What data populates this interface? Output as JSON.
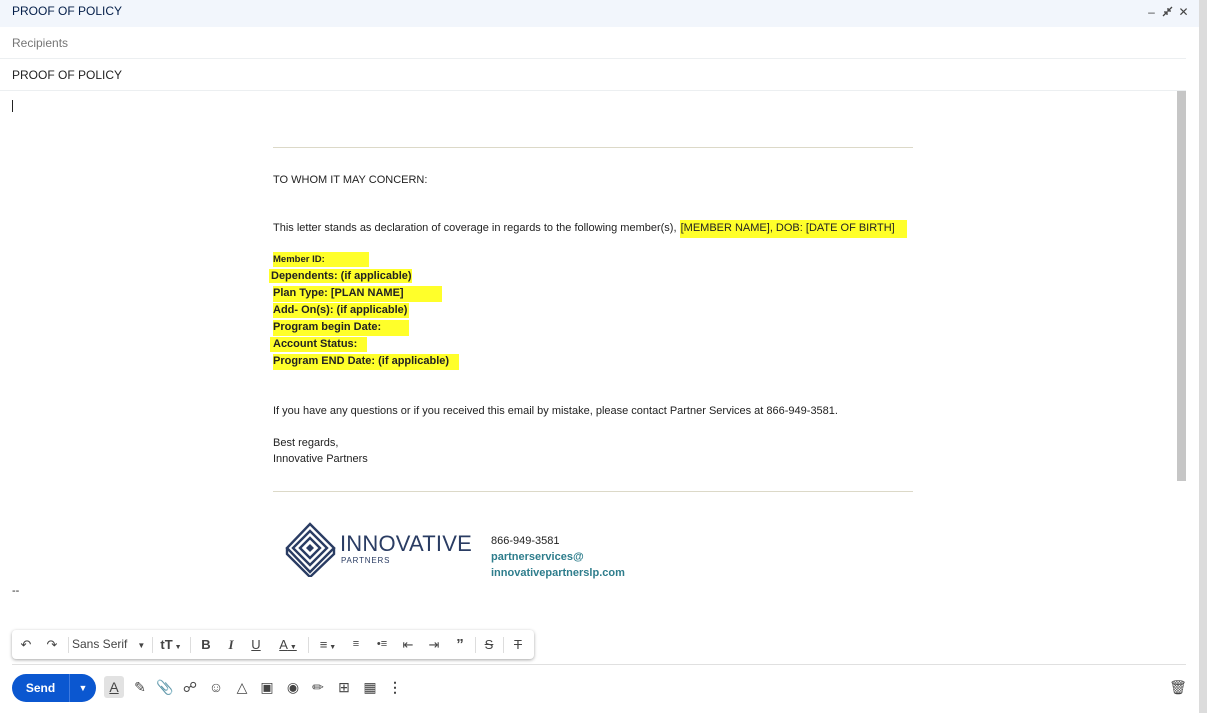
{
  "window": {
    "title": "PROOF OF POLICY",
    "minimize_icon": "minimize-icon",
    "popout_icon": "exit-fullscreen-icon",
    "close_icon": "close-icon"
  },
  "recipients": {
    "placeholder": "Recipients"
  },
  "subject": {
    "value": "PROOF OF POLICY"
  },
  "letter": {
    "salutation": "TO WHOM IT MAY CONCERN:",
    "intro": "This letter stands as declaration of coverage in regards to the following member(s),",
    "intro_highlight": "[MEMBER NAME], DOB:  [DATE OF BIRTH]",
    "fields": [
      "Member ID:",
      "Dependents: (if applicable)",
      "Plan Type:  [PLAN NAME]",
      "Add- On(s): (if applicable)",
      "Program begin Date:",
      "Account Status:",
      "Program END Date: (if applicable)"
    ],
    "questions": "If you have any questions or if you received this email by mistake, please contact Partner Services at 866-949-3581.",
    "closing": "Best regards,",
    "signature": "Innovative Partners"
  },
  "footer": {
    "logo_name": "INNOVATIVE",
    "logo_sub": "PARTNERS",
    "phone": "866-949-3581",
    "email_line1": "partnerservices@",
    "email_line2": "innovativepartnerslp.com"
  },
  "signature_separator": "--",
  "formatting_toolbar": {
    "font": "Sans Serif",
    "icons": [
      "undo-icon",
      "redo-icon",
      "font-size-icon",
      "bold-icon",
      "italic-icon",
      "underline-icon",
      "text-color-icon",
      "align-icon",
      "numbered-list-icon",
      "bulleted-list-icon",
      "indent-less-icon",
      "indent-more-icon",
      "quote-icon",
      "strikethrough-icon",
      "remove-formatting-icon"
    ]
  },
  "bottom_bar": {
    "send_label": "Send",
    "icons": [
      "formatting-options-icon",
      "ai-write-icon",
      "attach-icon",
      "link-icon",
      "emoji-icon",
      "drive-icon",
      "photo-icon",
      "confidential-lock-icon",
      "signature-icon",
      "template-icon",
      "schedule-icon",
      "more-options-icon",
      "discard-trash-icon"
    ]
  },
  "colors": {
    "titlebar_bg": "#f2f6fc",
    "highlight": "#ffff2a",
    "send_blue": "#0b57d0",
    "link_teal": "#2e7d8c",
    "logo_navy": "#2a3c63"
  }
}
